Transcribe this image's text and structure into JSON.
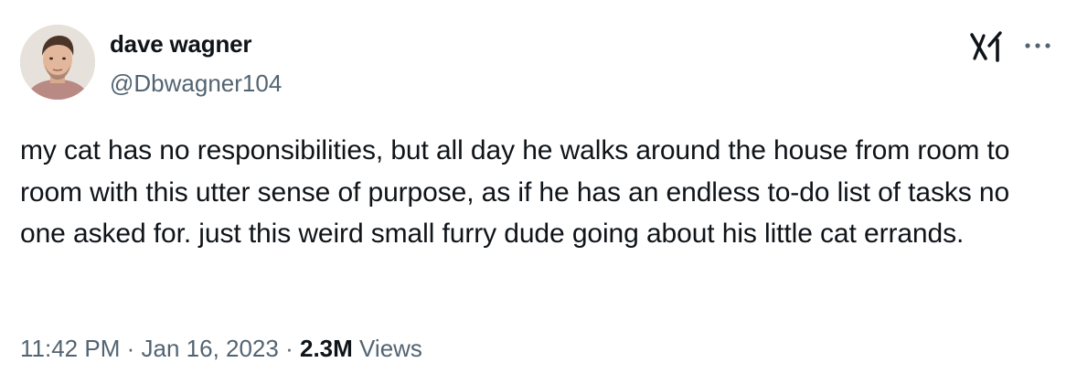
{
  "author": {
    "display_name": "dave wagner",
    "handle": "@Dbwagner104",
    "avatar_icon": "profile-photo"
  },
  "header_icons": {
    "logo": "x-logo-icon",
    "more": "more-options-icon"
  },
  "tweet": {
    "text": "my cat has no responsibilities, but all day he walks around the house from room to room with this utter sense of purpose, as if he has an endless to-do list of tasks no one asked for. just this weird small furry dude going about his little cat errands."
  },
  "meta": {
    "time": "11:42 PM",
    "separator": "·",
    "date": "Jan 16, 2023",
    "views_count": "2.3M",
    "views_label": "Views"
  },
  "colors": {
    "text_primary": "#0f1419",
    "text_secondary": "#536471",
    "background": "#ffffff"
  }
}
